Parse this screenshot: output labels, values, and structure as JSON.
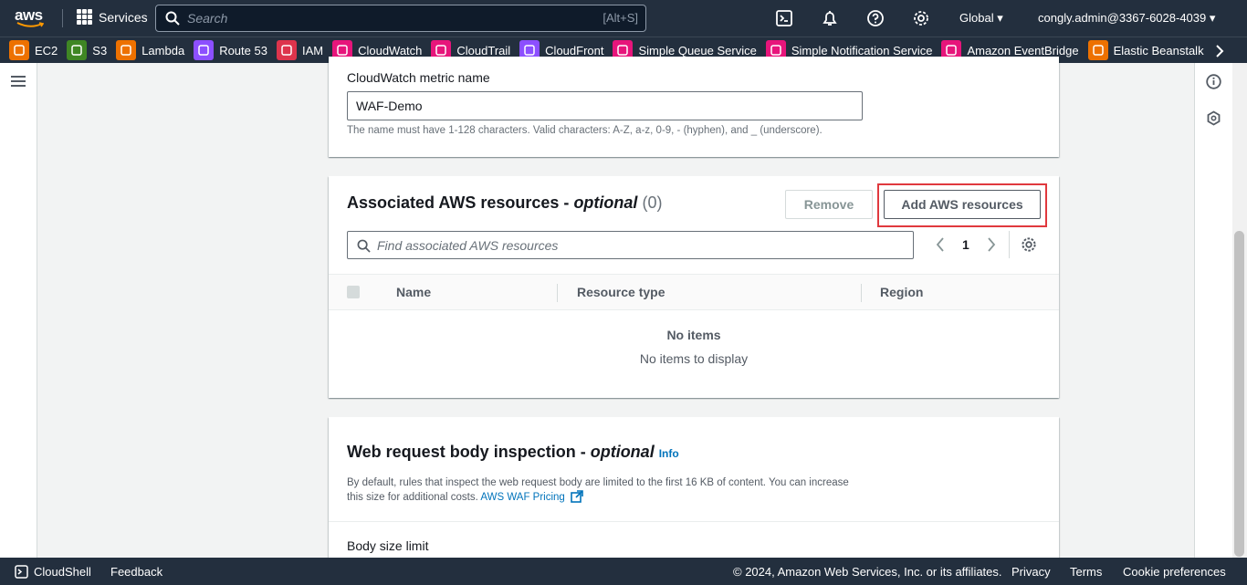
{
  "topbar": {
    "logo_text": "aws",
    "services_label": "Services",
    "search_placeholder": "Search",
    "search_shortcut": "[Alt+S]",
    "region": "Global",
    "account": "congly.admin@3367-6028-4039"
  },
  "favorites": [
    {
      "label": "EC2",
      "color": "#ed7100"
    },
    {
      "label": "S3",
      "color": "#3f8624"
    },
    {
      "label": "Lambda",
      "color": "#ed7100"
    },
    {
      "label": "Route 53",
      "color": "#8c4fff"
    },
    {
      "label": "IAM",
      "color": "#dd344c"
    },
    {
      "label": "CloudWatch",
      "color": "#e7157b"
    },
    {
      "label": "CloudTrail",
      "color": "#e7157b"
    },
    {
      "label": "CloudFront",
      "color": "#8c4fff"
    },
    {
      "label": "Simple Queue Service",
      "color": "#e7157b"
    },
    {
      "label": "Simple Notification Service",
      "color": "#e7157b"
    },
    {
      "label": "Amazon EventBridge",
      "color": "#e7157b"
    },
    {
      "label": "Elastic Beanstalk",
      "color": "#ed7100"
    }
  ],
  "metric": {
    "label": "CloudWatch metric name",
    "value": "WAF-Demo",
    "hint": "The name must have 1-128 characters. Valid characters: A-Z, a-z, 0-9, - (hyphen), and _ (underscore)."
  },
  "resources": {
    "title": "Associated AWS resources - ",
    "title_optional": "optional",
    "count": "(0)",
    "remove_label": "Remove",
    "add_label": "Add AWS resources",
    "find_placeholder": "Find associated AWS resources",
    "page": "1",
    "columns": [
      "Name",
      "Resource type",
      "Region"
    ],
    "empty_title": "No items",
    "empty_text": "No items to display"
  },
  "body_inspection": {
    "title": "Web request body inspection - ",
    "title_optional": "optional",
    "info": "Info",
    "desc_line1": "By default, rules that inspect the web request body are limited to the first 16 KB of content. You can increase",
    "desc_line2": "this size for additional costs. ",
    "pricing_link": "AWS WAF Pricing",
    "size_label": "Body size limit"
  },
  "footer": {
    "cloudshell": "CloudShell",
    "feedback": "Feedback",
    "copyright": "© 2024, Amazon Web Services, Inc. or its affiliates.",
    "privacy": "Privacy",
    "terms": "Terms",
    "cookies": "Cookie preferences"
  }
}
